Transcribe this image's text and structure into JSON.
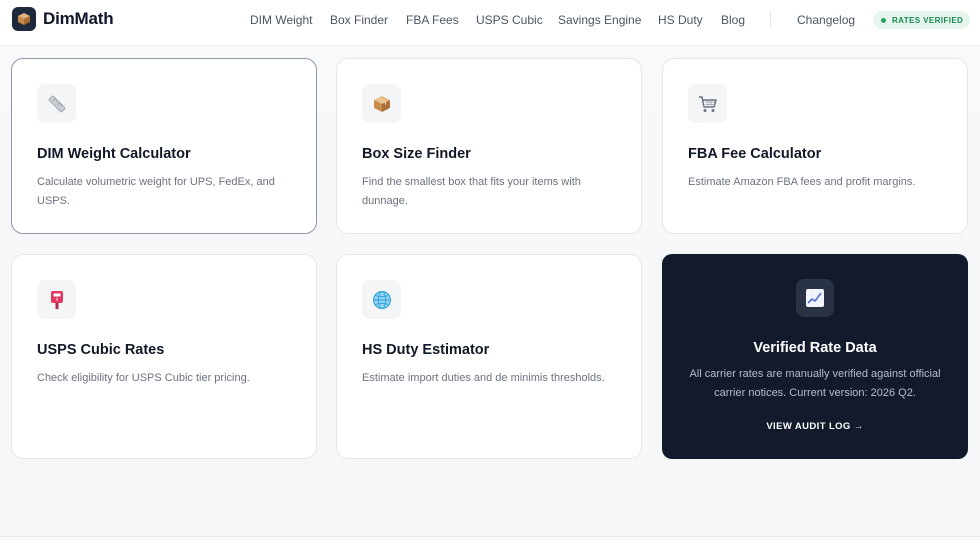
{
  "brand": {
    "name": "DimMath",
    "logo_icon": "package-icon"
  },
  "nav": {
    "links": [
      "DIM Weight",
      "Box Finder",
      "FBA Fees",
      "USPS Cubic",
      "Savings Engine",
      "HS Duty",
      "Blog"
    ],
    "changelog": "Changelog",
    "badge": "RATES VERIFIED"
  },
  "cards": [
    {
      "title": "DIM Weight Calculator",
      "description": "Calculate volumetric weight for UPS, FedEx, and USPS.",
      "icon": "ruler-icon",
      "selected": true
    },
    {
      "title": "Box Size Finder",
      "description": "Find the smallest box that fits your items with dunnage.",
      "icon": "package-icon"
    },
    {
      "title": "FBA Fee Calculator",
      "description": "Estimate Amazon FBA fees and profit margins.",
      "icon": "shopping-cart-icon"
    },
    {
      "title": "USPS Cubic Rates",
      "description": "Check eligibility for USPS Cubic tier pricing.",
      "icon": "postbox-icon"
    },
    {
      "title": "HS Duty Estimator",
      "description": "Estimate import duties and de minimis thresholds.",
      "icon": "globe-icon"
    }
  ],
  "verified": {
    "title": "Verified Rate Data",
    "description": "All carrier rates are manually verified against official carrier notices. Current version: 2026 Q2.",
    "link": "VIEW AUDIT LOG →",
    "icon": "chart-increasing-icon"
  },
  "colors": {
    "accent_dark": "#121a2c",
    "badge_green": "#198754",
    "badge_bg": "#e6f6ec"
  }
}
